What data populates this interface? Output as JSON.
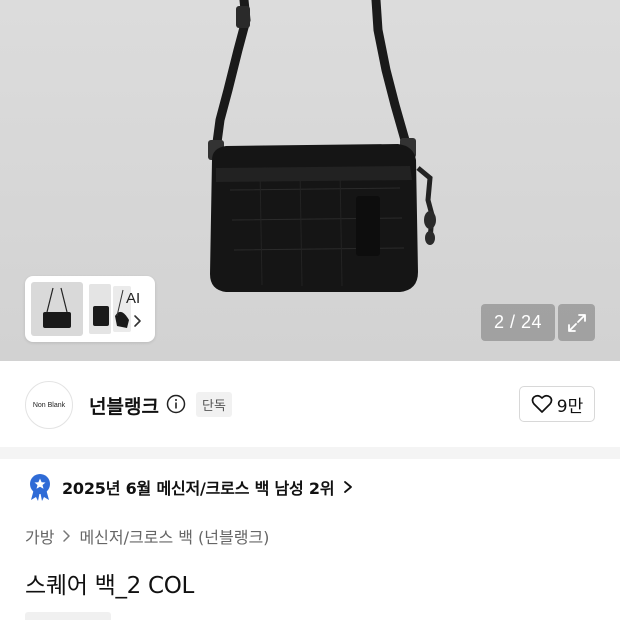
{
  "gallery": {
    "counter": "2 / 24",
    "ai_label": "AI"
  },
  "brand": {
    "logo_text": "Non Blank",
    "name": "넌블랭크",
    "exclusive_label": "단독",
    "likes": "9만"
  },
  "ranking": {
    "text": "2025년 6월 메신저/크로스 백 남성 2위"
  },
  "breadcrumb": [
    "가방",
    "메신저/크로스 백 (넌블랭크)"
  ],
  "product": {
    "title": "스퀘어 백_2 COL"
  },
  "colors": {
    "hero_bg": "#d6d6d6",
    "badge_blue": "#2f6bd6"
  },
  "icons": [
    "info-icon",
    "heart-icon",
    "expand-icon",
    "chevron-right-icon",
    "ranking-badge-icon"
  ]
}
